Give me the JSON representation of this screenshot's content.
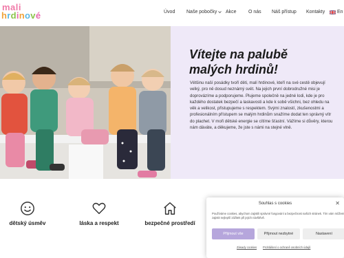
{
  "logo": {
    "line1": "mali",
    "line2": "hrdinové"
  },
  "nav": {
    "items": [
      "Úvod",
      "Naše pobočky",
      "Akce",
      "O nás",
      "Náš přístup",
      "Kontakty"
    ],
    "lang": "En"
  },
  "hero": {
    "title": "Vítejte na palubě malých hrdinů!",
    "text": "Většinu naší posádky tvoří děti, malí hrdinové, kteří na své cestě objevují velký, pro ně dosud neznámý svět. Na jejich první dobrodružné misi je doprovázíme a podporujeme. Plujeme společně na jedné lodi, kde je pro každého dostatek bezpečí a laskavosti a kde k sobě všichni, bez ohledu na věk a velikost, přistupujeme s respektem. Svými znalostí, zkušenostmi a profesionálním přístupem se malým hrdinům snažíme dodat ten správný vítr do plachet. V moři dětské energie se cítíme šťastní. Vážíme si důvěry, kterou nám dáváte, a děkujeme, že jste s námi na stejné vlně."
  },
  "features": [
    {
      "icon": "smile-icon",
      "label": "dětský úsměv"
    },
    {
      "icon": "heart-icon",
      "label": "láska a respekt"
    },
    {
      "icon": "home-icon",
      "label": "bezpečné prostředí"
    }
  ],
  "cookie": {
    "title": "Souhlas s cookies",
    "text": "Používáme cookies, abychom zajistili správné fungování a bezpečnost našich stránek. Tím vám můžeme zajistit nejlepší zážitek při jejich návštěvě.",
    "accept": "Přijmout vše",
    "needed": "Přijmout nezbytné",
    "settings": "Nastavení",
    "link1": "Zásady cookies",
    "link2": "Prohlášení o ochraně osobních údajů"
  },
  "colors": {
    "accent": "#b6a6dc",
    "panel": "#efe9f8"
  }
}
